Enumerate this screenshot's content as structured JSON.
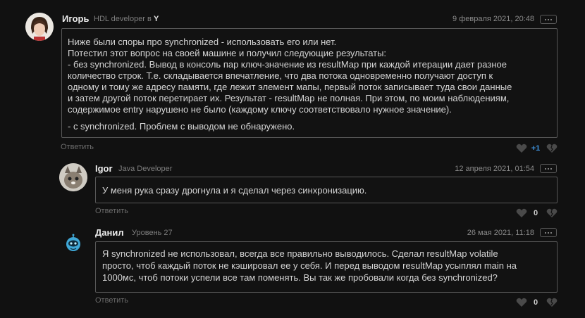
{
  "comments": [
    {
      "author": "Игорь",
      "role_prefix": "HDL developer в",
      "company": "Y",
      "date": "9 февраля 2021, 20:48",
      "lines": [
        "Ниже были споры про synchronized - использовать его или нет.",
        "Потестил этот вопрос на своей машине и получил следующие результаты:",
        "- без synchronized. Вывод в консоль пар ключ-значение из resultMap при каждой итерации дает разное",
        "количество строк. Т.е. складывается впечатление, что два потока одновременно получают доступ к",
        "одному и тому же адресу памяти, где лежит элемент мапы, первый поток записывает туда свои данные",
        "и затем другой поток перетирает их. Результат - resultMap не полная. При этом, по моим наблюдениям,",
        "содержимое entry нарушено не было (каждому ключу соответствовало нужное значение).",
        "-  с synchronized. Проблем с выводом не обнаружено."
      ],
      "reply_label": "Ответить",
      "votes": "+1"
    },
    {
      "author": "Igor",
      "role": "Java Developer",
      "date": "12 апреля 2021, 01:54",
      "lines": [
        "У меня рука сразу дрогнула и я сделал через синхронизацию."
      ],
      "reply_label": "Ответить",
      "votes": "0"
    },
    {
      "author": "Данил",
      "role": "Уровень 27",
      "date": "26 мая 2021, 11:18",
      "lines": [
        "Я synchronized не использовал, всегда все правильно выводилось. Сделал resultMap volatile",
        "просто, чтоб каждый поток не кэшировал ее у себя. И перед выводом resultMap усыплял main на",
        "1000мс, чтоб потоки успели все там поменять. Вы так же пробовали когда без synchronized?"
      ],
      "reply_label": "Ответить",
      "votes": "0"
    }
  ],
  "colors": {
    "background": "#111111",
    "positive_vote": "#3d8fd8",
    "border": "#575757"
  },
  "icons": [
    "avatar",
    "more-icon",
    "like-heart-icon",
    "dislike-heart-icon"
  ]
}
